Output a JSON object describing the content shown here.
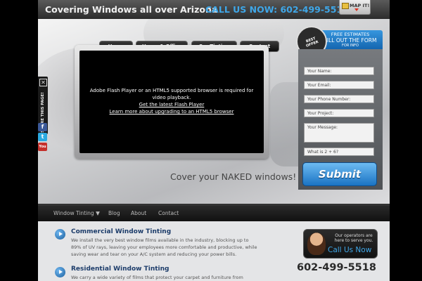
{
  "header": {
    "title": "Covering Windows all over Arizona",
    "call": "CALL US NOW: 602-499-5518",
    "map_label": "MAP IT!"
  },
  "nav": [
    "Home",
    "Home & Office",
    "Car Tinting",
    "Contact"
  ],
  "video": {
    "message": "Adobe Flash Player or an HTML5 supported browser is required for video playback.",
    "link1": "Get the latest Flash Player",
    "link2": "Learn more about upgrading to an HTML5 browser"
  },
  "tagline": "Cover your NAKED windows!",
  "share": {
    "label": "SHARE THIS PAGE!",
    "facebook": "f",
    "twitter": "t",
    "youtube": "You"
  },
  "form": {
    "badge": "BEST OFFER",
    "estimates_line1": "FREE ESTIMATES",
    "estimates_line2": "FILL OUT THE FORM",
    "estimates_line3": "FOR INFO",
    "name": "Your Name:",
    "email": "Your Email:",
    "phone": "Your Phone Number:",
    "project": "Your Project:",
    "message": "Your Message:",
    "captcha": "What is 2 + 6?",
    "submit": "Submit"
  },
  "menu": [
    "Window Tinting ▼",
    "Blog",
    "About",
    "Contact"
  ],
  "services": [
    {
      "title": "Commercial Window Tinting",
      "desc": "We install the very best window films available in the industry, blocking up to 89% of UV rays, leaving your employees more comfortable and productive, while saving wear and tear on your A/C system and reducing your power bills."
    },
    {
      "title": "Residential Window Tinting",
      "desc": "We carry a wide variety of films that protect your carpet and furniture from"
    }
  ],
  "operators": {
    "text": "Our operators are here to serve you.",
    "call": "Call Us Now"
  },
  "phone": "602-499-5518"
}
